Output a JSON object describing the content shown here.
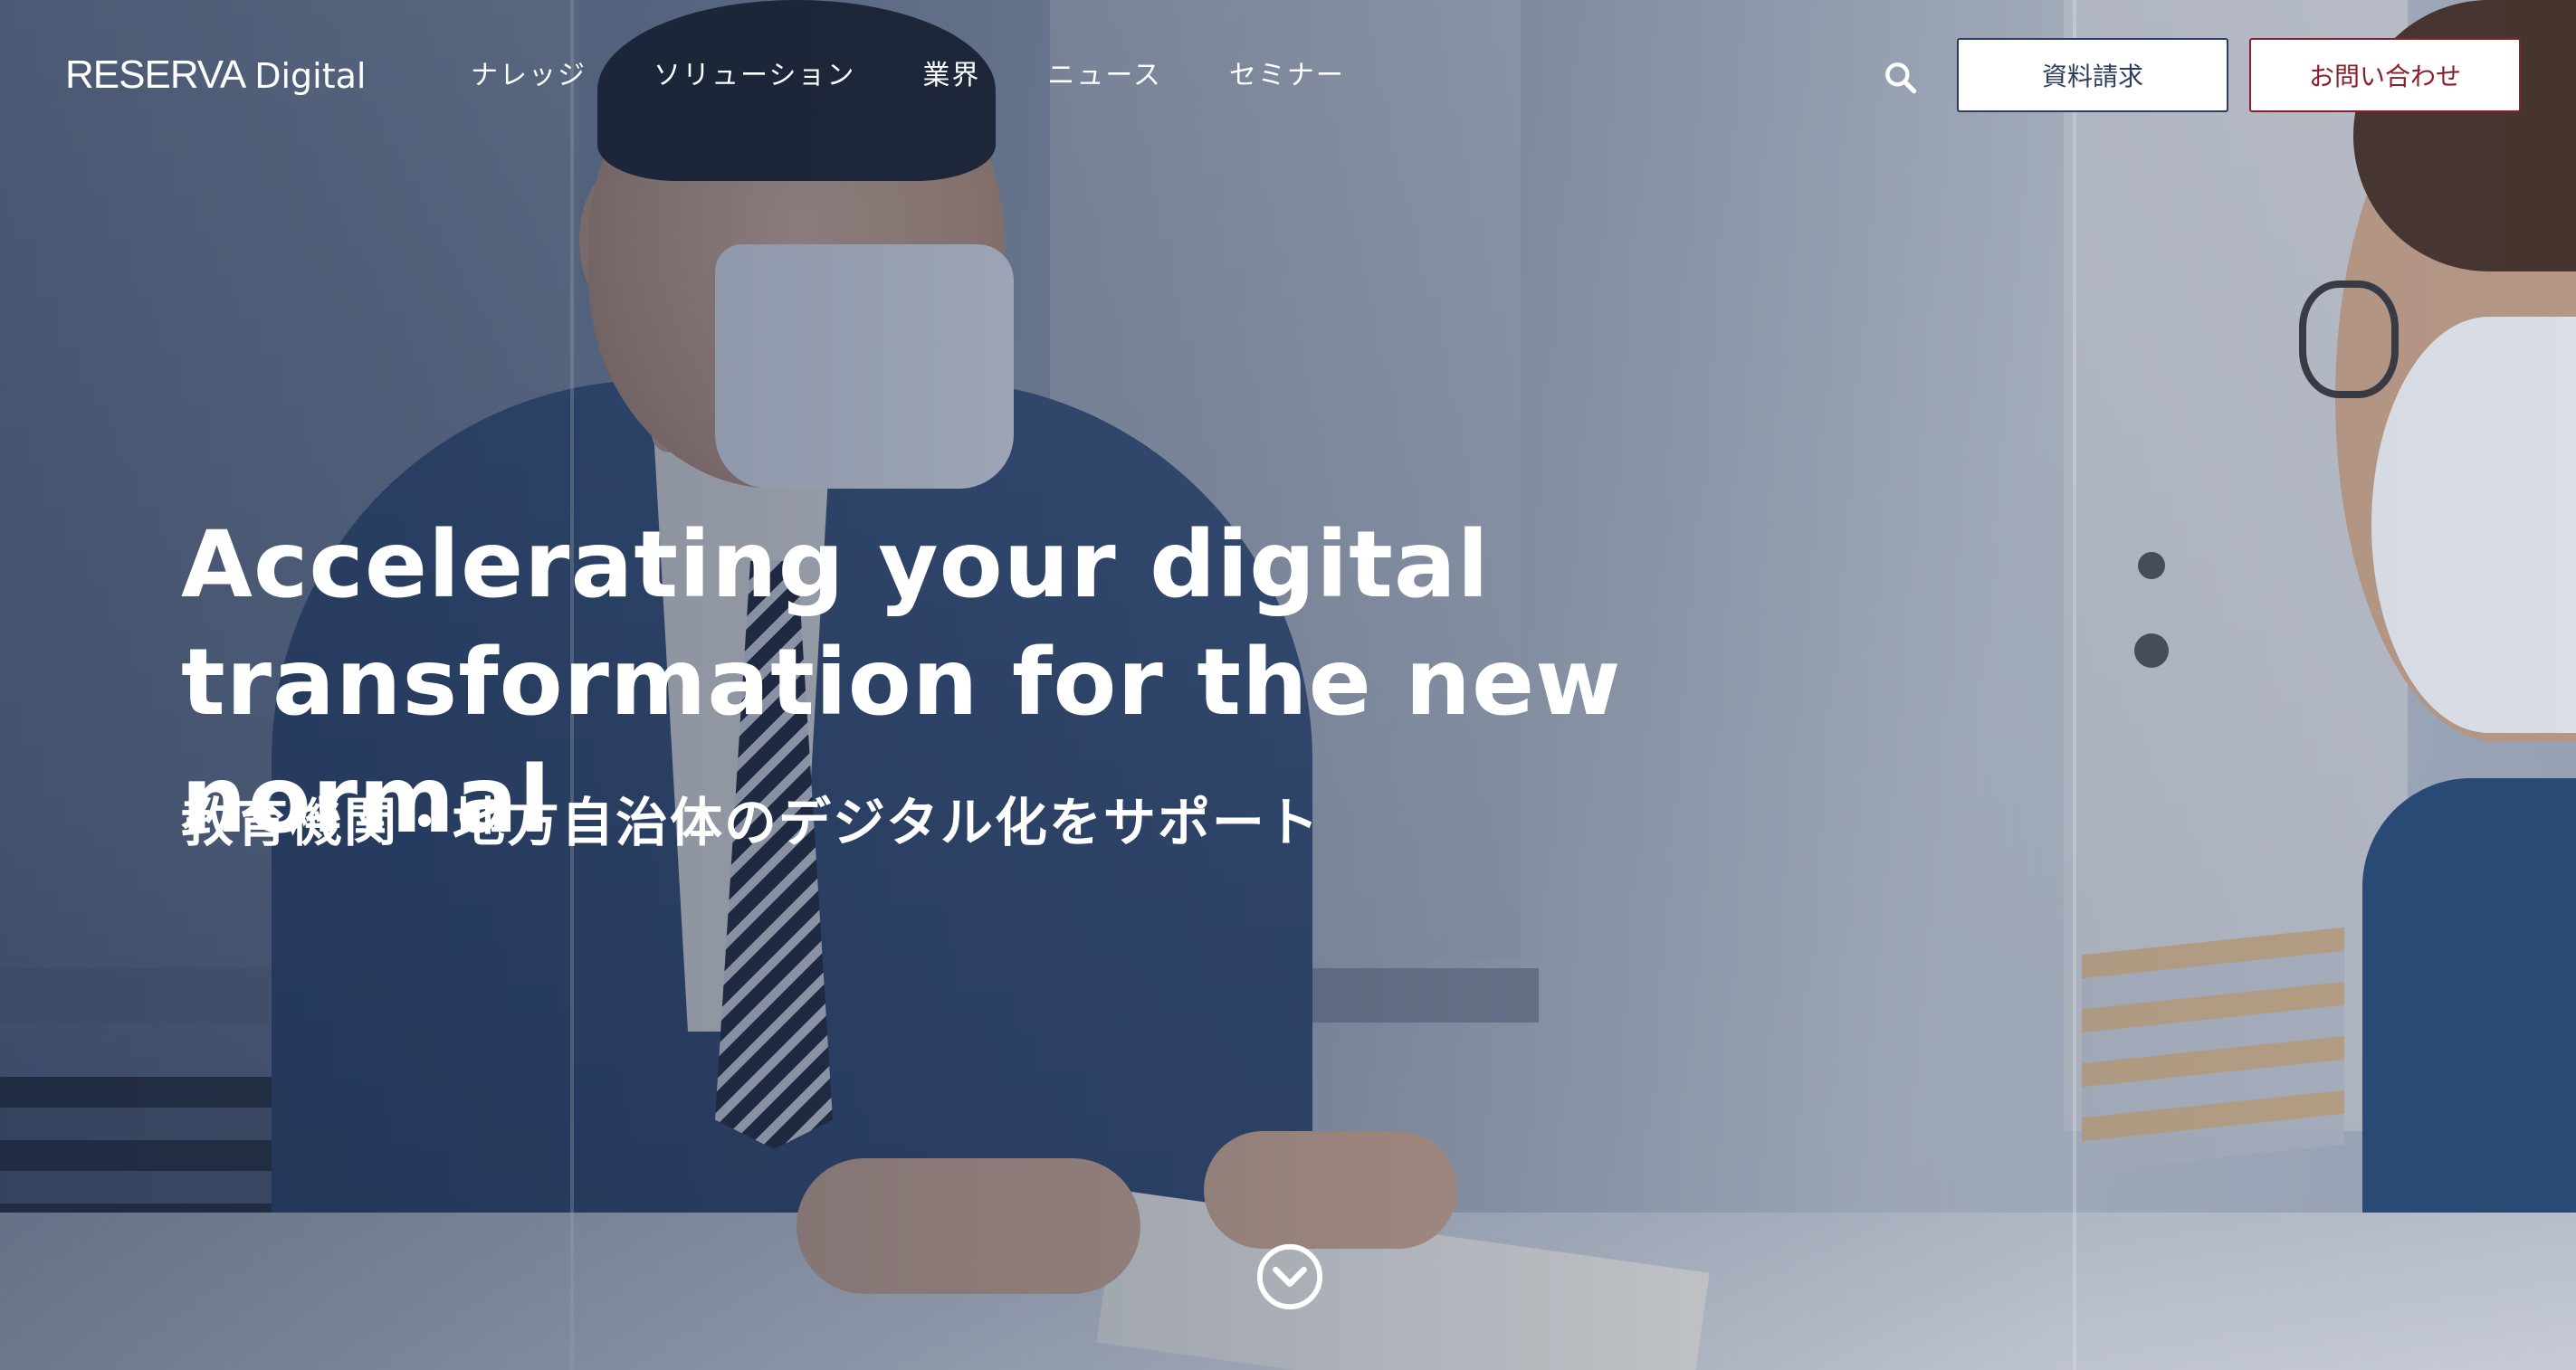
{
  "header": {
    "logo_main": "RESERVA",
    "logo_sub": "Digital",
    "nav": [
      "ナレッジ",
      "ソリューション",
      "業界",
      "ニュース",
      "セミナー"
    ],
    "search_icon": "search-icon",
    "docs_button": "資料請求",
    "contact_button": "お問い合わせ"
  },
  "hero": {
    "headline_line1": "Accelerating your digital",
    "headline_line2": "transformation for the new normal",
    "subline": "教育機関・地方自治体のデジタル化をサポート",
    "scroll_icon": "chevron-down-circle-icon"
  },
  "colors": {
    "text_on_photo": "#ffffff",
    "docs_accent": "#2c3d5f",
    "contact_accent": "#8a1f2c"
  }
}
